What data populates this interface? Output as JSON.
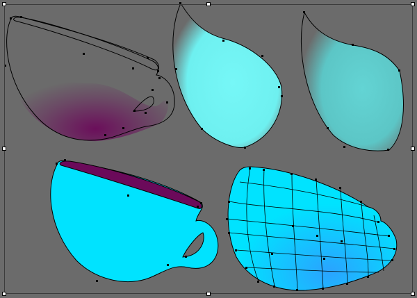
{
  "canvas": {
    "background": "#6b6b6b",
    "selection_frame_color": "#3c3c3c",
    "handle_color": "#ffffff"
  },
  "colors": {
    "cyan_fill": "#00e3ff",
    "cyan_light": "#6ff2f2",
    "teal_shade": "#5cc6c6",
    "coffee_purple": "#6b0a5a",
    "mesh_blue": "#2aa9ff",
    "outline": "#000000"
  },
  "objects": [
    {
      "name": "cup-outline-with-coffee-tint",
      "icon": "teacup-icon"
    },
    {
      "name": "cyan-highlight-blob",
      "icon": "gradient-shape-icon"
    },
    {
      "name": "teal-shade-blob",
      "icon": "gradient-shape-icon"
    },
    {
      "name": "cyan-filled-cup",
      "icon": "teacup-icon"
    },
    {
      "name": "gradient-mesh-cup",
      "icon": "mesh-icon"
    }
  ]
}
